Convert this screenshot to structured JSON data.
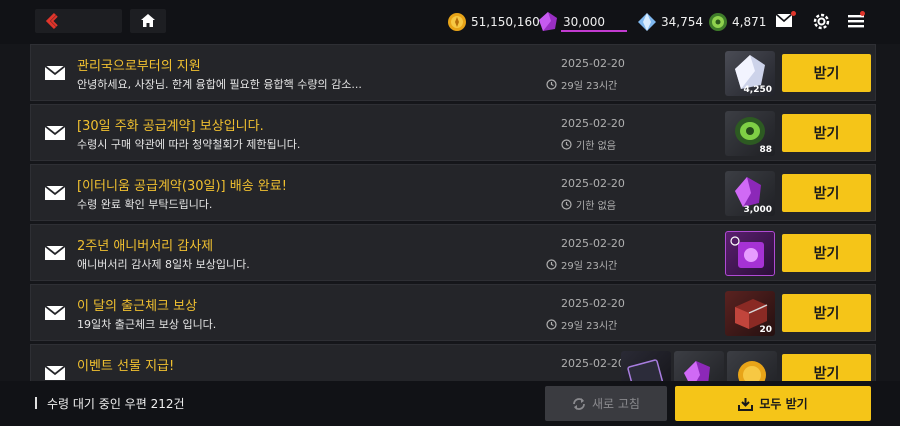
{
  "currencies": {
    "gold": "51,150,160",
    "purple": "30,000",
    "diamond": "34,754",
    "green": "4,871"
  },
  "mails": [
    {
      "title": "관리국으로부터의 지원",
      "desc": "안녕하세요, 사장님. 한계 융합에 필요한 융합핵 수량의 감소...",
      "date": "2025-02-20",
      "expire": "29일 23시간",
      "reward_count": "4,250",
      "reward_icon": "white-crystal-icon",
      "button": "받기"
    },
    {
      "title": "[30일 주화 공급계약] 보상입니다.",
      "desc": "수령시 구매 약관에 따라 청약철회가 제한됩니다.",
      "date": "2025-02-20",
      "expire": "기한 없음",
      "reward_count": "88",
      "reward_icon": "green-coin-icon",
      "button": "받기"
    },
    {
      "title": "[이터니움 공급계약(30일)] 배송 완료!",
      "desc": "수령 완료 확인 부탁드립니다.",
      "date": "2025-02-20",
      "expire": "기한 없음",
      "reward_count": "3,000",
      "reward_icon": "purple-crystal-icon",
      "button": "받기"
    },
    {
      "title": "2주년 애니버서리 감사제",
      "desc": "애니버서리 감사제 8일차 보상입니다.",
      "date": "2025-02-20",
      "expire": "29일 23시간",
      "reward_count": "",
      "reward_icon": "purple-ticket-icon",
      "button": "받기"
    },
    {
      "title": "이 달의 출근체크 보상",
      "desc": "19일차 출근체크 보상 입니다.",
      "date": "2025-02-20",
      "expire": "29일 23시간",
      "reward_count": "20",
      "reward_icon": "red-box-icon",
      "button": "받기"
    },
    {
      "title": "이벤트 선물 지급!",
      "desc": "",
      "date": "2025-02-20",
      "expire": "",
      "reward_count": "",
      "reward_icon": "multi-reward-icon",
      "button": "받기"
    }
  ],
  "footer": {
    "pending": "수령 대기 중인 우편 212건",
    "refresh": "새로 고침",
    "receive_all": "모두 받기"
  },
  "colors": {
    "accent": "#f5c518",
    "title": "#f0c030",
    "purple_bar": "#c23bd0"
  }
}
